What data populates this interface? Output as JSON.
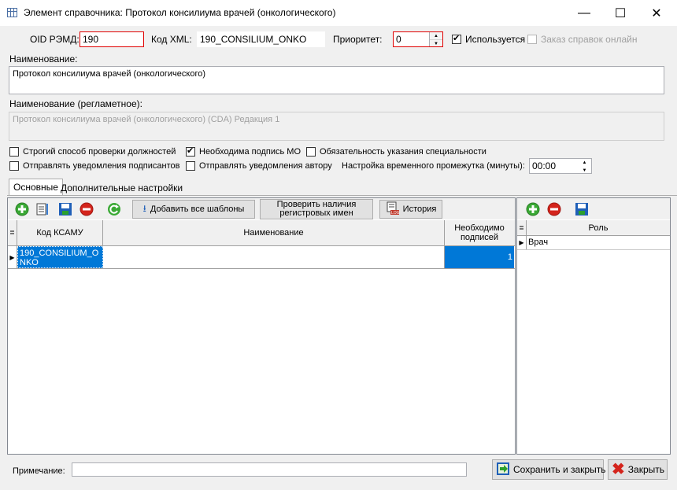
{
  "window": {
    "title": "Элемент справочника: Протокол консилиума врачей (онкологического)",
    "minimize": "—",
    "maximize": "☐",
    "close": "✕"
  },
  "fields": {
    "oid_label": "OID РЭМД:",
    "oid_value": "190",
    "xml_label": "Код XML:",
    "xml_value": "190_CONSILIUM_ONKO",
    "priority_label": "Приоритет:",
    "priority_value": "0",
    "used_label": "Используется",
    "online_label": "Заказ справок онлайн",
    "name_label": "Наименование:",
    "name_value": "Протокол консилиума врачей (онкологического)",
    "reg_name_label": "Наименование (регламетное):",
    "reg_name_value": "Протокол консилиума врачей (онкологического) (CDA) Редакция 1"
  },
  "options": {
    "strict_check": "Строгий способ проверки должностей",
    "need_sign_mo": "Необходима подпись МО",
    "spec_required": "Обязательность указания специальности",
    "notify_signers": "Отправлять уведомления подписантов",
    "notify_author": "Отправлять уведомления автору",
    "time_label": "Настройка временного промежутка (минуты):",
    "time_value": "00:00"
  },
  "tabs": {
    "main": "Основные",
    "extra": "Дополнительные настройки"
  },
  "toolbar": {
    "add_all_templates": "Добавить все шаблоны",
    "check_reg_names": "Проверить наличия регистровых имен",
    "history": "История"
  },
  "grid": {
    "col_code": "Код КСАМУ",
    "col_name": "Наименование",
    "col_signs": "Необходимо подписей",
    "rows": [
      {
        "code": "190_CONSILIUM_ONKO",
        "name": "",
        "signs": "1"
      }
    ]
  },
  "roles": {
    "col_role": "Роль",
    "rows": [
      {
        "role": "Врач"
      }
    ]
  },
  "footer": {
    "note_label": "Примечание:",
    "note_value": "",
    "save_close": "Сохранить и закрыть",
    "close": "Закрыть"
  },
  "colors": {
    "accent": "#0078d7",
    "error_border": "#e00000",
    "add_green": "#3aa935",
    "remove_red": "#d4241c"
  }
}
